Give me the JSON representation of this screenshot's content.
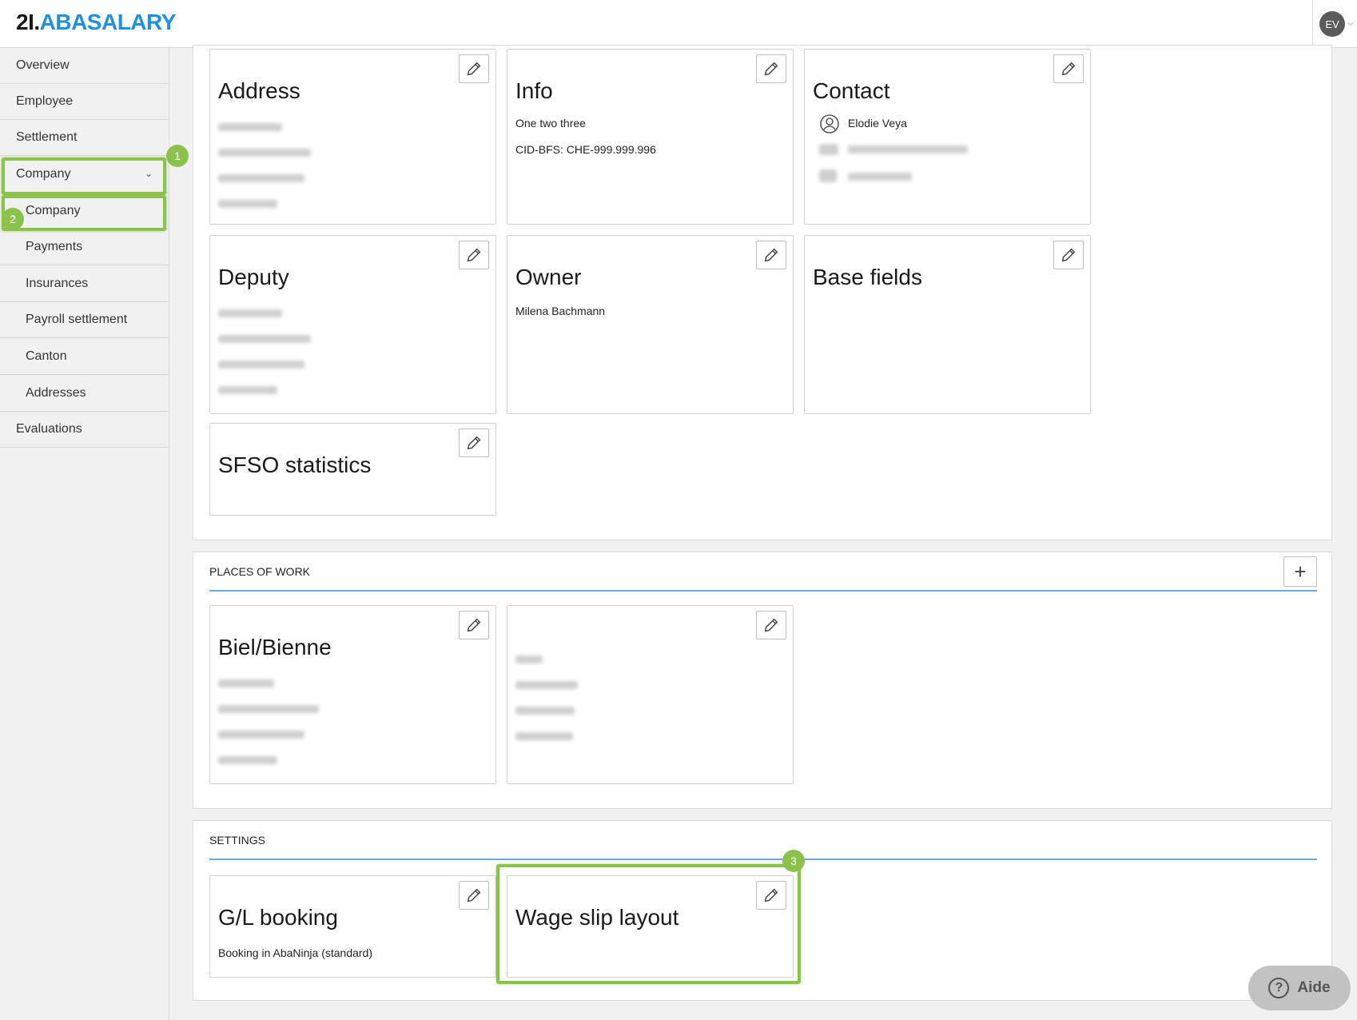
{
  "header": {
    "logo_prefix": "2I.",
    "logo_brand": "ABASALARY",
    "user_initials": "EV"
  },
  "sidebar": {
    "items": [
      {
        "label": "Overview"
      },
      {
        "label": "Employee"
      },
      {
        "label": "Settlement"
      },
      {
        "label": "Company"
      },
      {
        "label": "Company"
      },
      {
        "label": "Payments"
      },
      {
        "label": "Insurances"
      },
      {
        "label": "Payroll settlement"
      },
      {
        "label": "Canton"
      },
      {
        "label": "Addresses"
      },
      {
        "label": "Evaluations"
      }
    ]
  },
  "markers": [
    "1",
    "2",
    "3"
  ],
  "company_cards": {
    "address": {
      "title": "Address"
    },
    "info": {
      "title": "Info",
      "line1": "One two three",
      "line2": "CID-BFS: CHE-999.999.996"
    },
    "contact": {
      "title": "Contact",
      "name": "Elodie Veya"
    },
    "deputy": {
      "title": "Deputy"
    },
    "owner": {
      "title": "Owner",
      "name": "Milena Bachmann"
    },
    "base_fields": {
      "title": "Base fields"
    },
    "sfso": {
      "title": "SFSO statistics"
    }
  },
  "places_of_work": {
    "label": "PLACES OF WORK",
    "card1_title": "Biel/Bienne"
  },
  "settings": {
    "label": "SETTINGS",
    "gl_title": "G/L booking",
    "gl_value": "Booking in AbaNinja (standard)",
    "wage_title": "Wage slip layout"
  },
  "help": {
    "label": "Aide"
  },
  "colors": {
    "accent": "#1f8fe0",
    "highlight": "#8bc34a",
    "section_line": "#6fa8dc"
  }
}
